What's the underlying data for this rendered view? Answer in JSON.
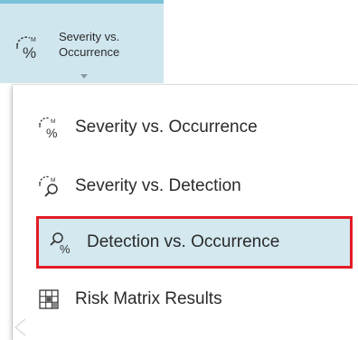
{
  "ribbon": {
    "button_line1": "Severity vs.",
    "button_line2": "Occurrence"
  },
  "menu": {
    "items": [
      {
        "label": "Severity vs. Occurrence",
        "icon": "severity-occurrence-icon"
      },
      {
        "label": "Severity vs. Detection",
        "icon": "severity-detection-icon"
      },
      {
        "label": "Detection vs. Occurrence",
        "icon": "detection-occurrence-icon",
        "selected": true
      },
      {
        "label": "Risk Matrix Results",
        "icon": "risk-matrix-icon"
      }
    ]
  },
  "colors": {
    "ribbon_bg": "#cfe6ee",
    "ribbon_top_border": "#7ac3d9",
    "selected_bg": "#d3e8ef",
    "highlight_outline": "#e21c26"
  }
}
